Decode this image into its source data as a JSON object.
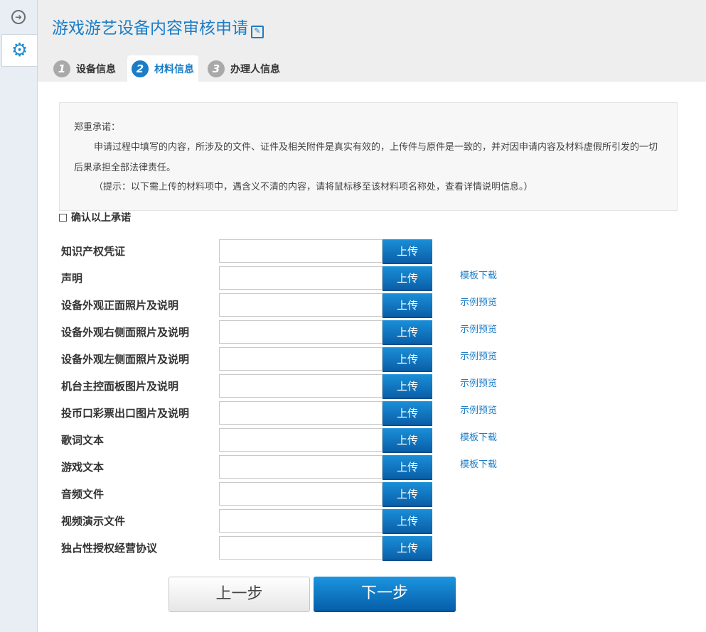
{
  "sidebar": {
    "exit_icon": "exit-icon",
    "gear_icon": "gear-icon"
  },
  "header": {
    "title": "游戏游艺设备内容审核申请",
    "edit_icon": "edit-icon"
  },
  "tabs": [
    {
      "num": "1",
      "label": "设备信息",
      "active": false
    },
    {
      "num": "2",
      "label": "材料信息",
      "active": true
    },
    {
      "num": "3",
      "label": "办理人信息",
      "active": false
    }
  ],
  "notice": {
    "heading": "郑重承诺：",
    "body": "申请过程中填写的内容，所涉及的文件、证件及相关附件是真实有效的，上传件与原件是一致的，并对因申请内容及材料虚假所引发的一切后果承担全部法律责任。",
    "hint": "（提示：以下需上传的材料项中，遇含义不清的内容，请将鼠标移至该材料项名称处，查看详情说明信息。）"
  },
  "confirm": {
    "label": "确认以上承诺",
    "checked": false
  },
  "upload_label": "上传",
  "rows": [
    {
      "label": "知识产权凭证",
      "link": ""
    },
    {
      "label": "声明",
      "link": "模板下载"
    },
    {
      "label": "设备外观正面照片及说明",
      "link": "示例预览"
    },
    {
      "label": "设备外观右侧面照片及说明",
      "link": "示例预览"
    },
    {
      "label": "设备外观左侧面照片及说明",
      "link": "示例预览"
    },
    {
      "label": "机台主控面板图片及说明",
      "link": "示例预览"
    },
    {
      "label": "投币口彩票出口图片及说明",
      "link": "示例预览"
    },
    {
      "label": "歌词文本",
      "link": "模板下载"
    },
    {
      "label": "游戏文本",
      "link": "模板下载"
    },
    {
      "label": "音频文件",
      "link": ""
    },
    {
      "label": "视频演示文件",
      "link": ""
    },
    {
      "label": "独占性授权经营协议",
      "link": ""
    }
  ],
  "buttons": {
    "prev": "上一步",
    "next": "下一步"
  },
  "colors": {
    "accent": "#1b7dc6",
    "button_blue": "#0a5fa8"
  }
}
